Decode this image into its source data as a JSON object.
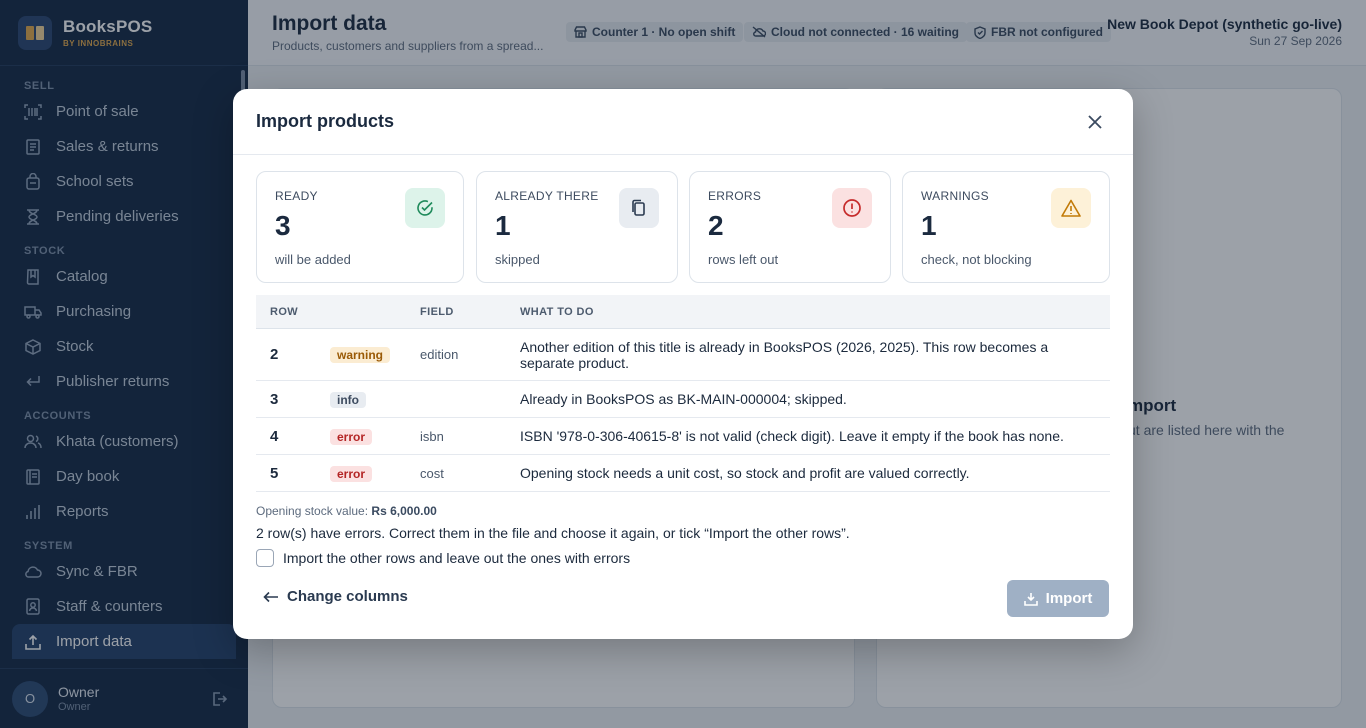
{
  "brand": {
    "name": "BooksPOS",
    "sub": "BY INNOBRAINS"
  },
  "sidebar": {
    "sections": [
      {
        "title": "SELL",
        "items": [
          {
            "label": "Point of sale",
            "icon": "barcode-icon"
          },
          {
            "label": "Sales & returns",
            "icon": "receipt-icon"
          },
          {
            "label": "School sets",
            "icon": "bag-icon"
          },
          {
            "label": "Pending deliveries",
            "icon": "hourglass-icon"
          }
        ]
      },
      {
        "title": "STOCK",
        "items": [
          {
            "label": "Catalog",
            "icon": "book-icon"
          },
          {
            "label": "Purchasing",
            "icon": "truck-icon"
          },
          {
            "label": "Stock",
            "icon": "box-icon"
          },
          {
            "label": "Publisher returns",
            "icon": "return-icon"
          }
        ]
      },
      {
        "title": "ACCOUNTS",
        "items": [
          {
            "label": "Khata (customers)",
            "icon": "users-icon"
          },
          {
            "label": "Day book",
            "icon": "ledger-icon"
          },
          {
            "label": "Reports",
            "icon": "bar-chart-icon"
          }
        ]
      },
      {
        "title": "SYSTEM",
        "items": [
          {
            "label": "Sync & FBR",
            "icon": "cloud-icon"
          },
          {
            "label": "Staff & counters",
            "icon": "badge-icon"
          },
          {
            "label": "Import data",
            "icon": "upload-icon",
            "active": true
          }
        ]
      }
    ],
    "user": {
      "initial": "O",
      "name": "Owner",
      "role": "Owner"
    }
  },
  "header": {
    "title": "Import data",
    "subtitle": "Products, customers and suppliers from a spread...",
    "chips": [
      {
        "label": "Counter 1 · No open shift",
        "icon": "store-icon"
      },
      {
        "label": "Cloud not connected · 16 waiting",
        "icon": "cloud-off-icon"
      },
      {
        "label": "FBR not configured",
        "icon": "shield-icon"
      }
    ],
    "store_name": "New Book Depot (synthetic go-live)",
    "date": "Sun 27 Sep 2026"
  },
  "background": {
    "title": "mport",
    "text": "ut are listed here with the"
  },
  "modal": {
    "title": "Import products",
    "stats": [
      {
        "label": "READY",
        "value": "3",
        "note": "will be added",
        "icon": "check-circle-icon",
        "bg": "#ddf3ea",
        "color": "#1f8a5b"
      },
      {
        "label": "ALREADY THERE",
        "value": "1",
        "note": "skipped",
        "icon": "copy-icon",
        "bg": "#e8ecf1",
        "color": "#2a3a50"
      },
      {
        "label": "ERRORS",
        "value": "2",
        "note": "rows left out",
        "icon": "alert-circle-icon",
        "bg": "#fbe1e1",
        "color": "#c62b2b"
      },
      {
        "label": "WARNINGS",
        "value": "1",
        "note": "check, not blocking",
        "icon": "warning-triangle-icon",
        "bg": "#fdf1d8",
        "color": "#c27a07"
      }
    ],
    "table": {
      "headers": {
        "row": "ROW",
        "field": "FIELD",
        "what": "WHAT TO DO"
      },
      "rows": [
        {
          "row": "2",
          "level": "warning",
          "field": "edition",
          "message": "Another edition of this title is already in BooksPOS (2026, 2025). This row becomes a separate product."
        },
        {
          "row": "3",
          "level": "info",
          "field": "",
          "message": "Already in BooksPOS as BK-MAIN-000004; skipped."
        },
        {
          "row": "4",
          "level": "error",
          "field": "isbn",
          "message": "ISBN '978-0-306-40615-8' is not valid (check digit). Leave it empty if the book has none."
        },
        {
          "row": "5",
          "level": "error",
          "field": "cost",
          "message": "Opening stock needs a unit cost, so stock and profit are valued correctly."
        }
      ]
    },
    "opening_label": "Opening stock value:",
    "opening_value": "Rs 6,000.00",
    "error_note": "2 row(s) have errors. Correct them in the file and choose it again, or tick “Import the other rows”.",
    "checkbox_label": "Import the other rows and leave out the ones with errors",
    "change_columns": "Change columns",
    "import": "Import"
  }
}
